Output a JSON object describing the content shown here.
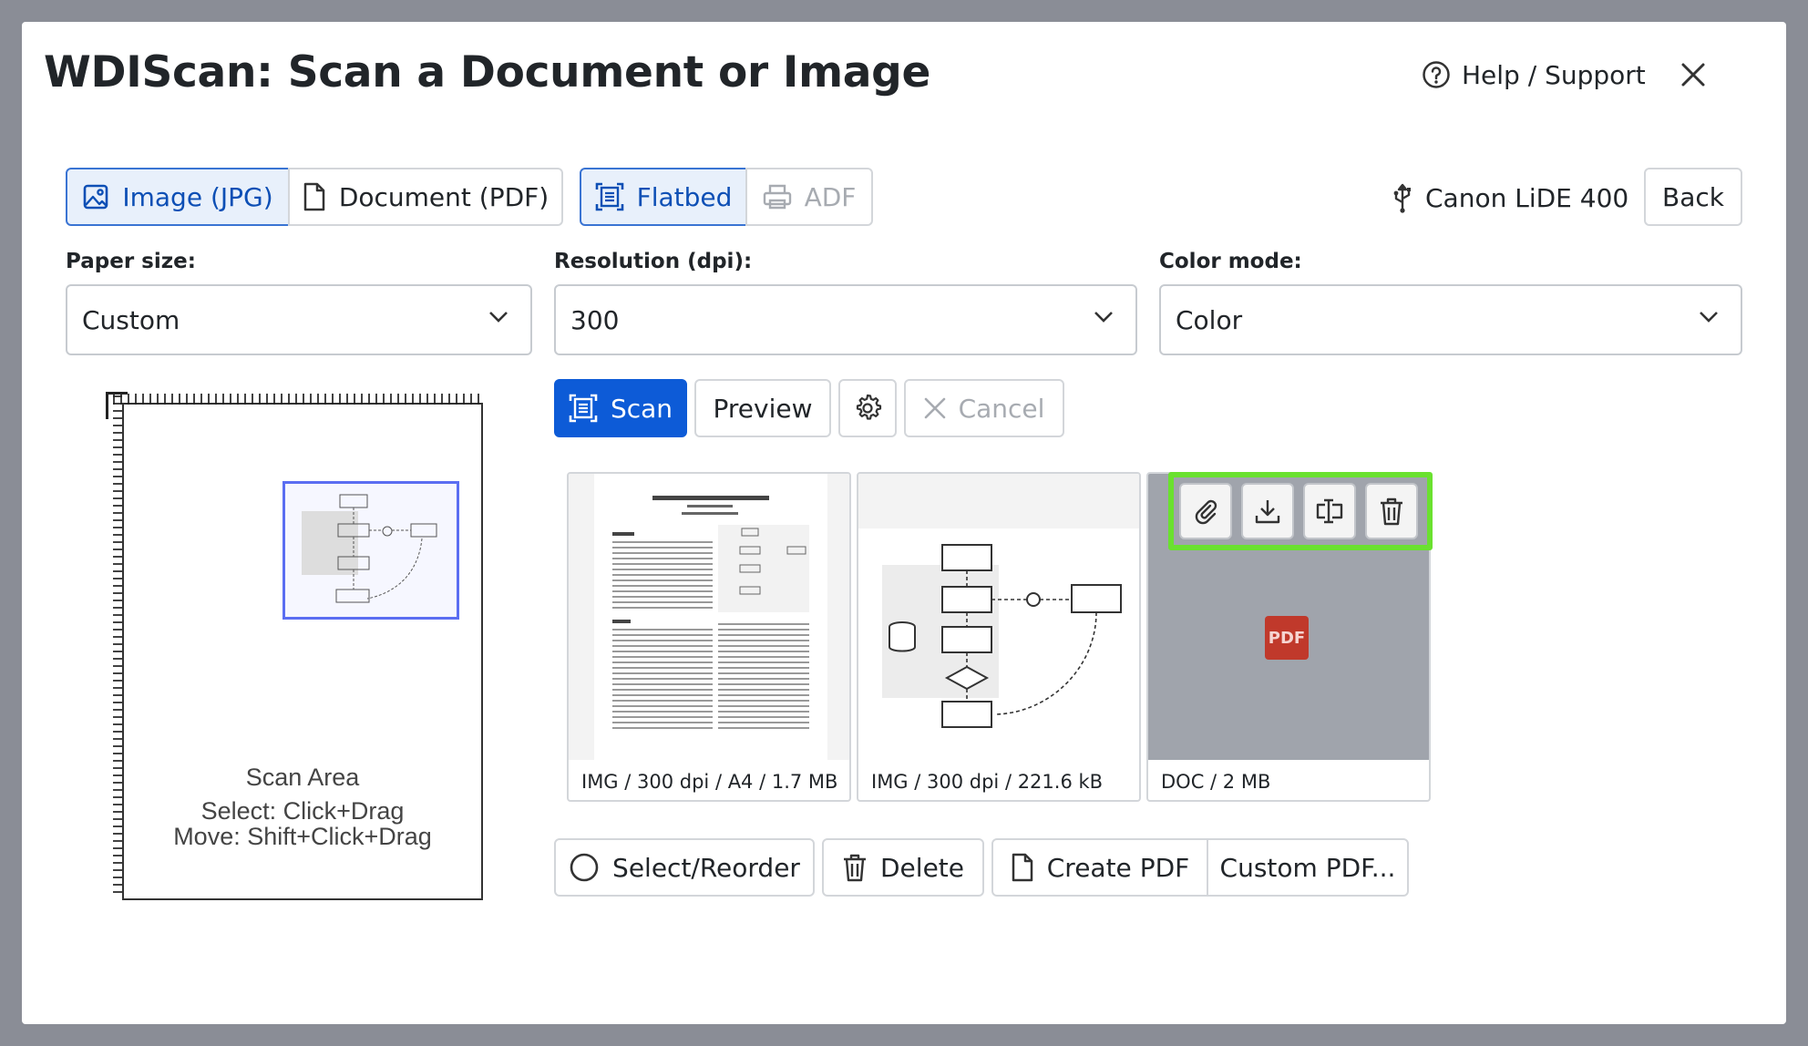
{
  "dialog": {
    "title": "WDIScan: Scan a Document or Image",
    "help_label": "Help / Support"
  },
  "format_tabs": [
    {
      "label": "Image (JPG)",
      "icon": "image-icon",
      "active": true
    },
    {
      "label": "Document (PDF)",
      "icon": "document-icon",
      "active": false
    }
  ],
  "source_tabs": [
    {
      "label": "Flatbed",
      "icon": "flatbed-icon",
      "active": true
    },
    {
      "label": "ADF",
      "icon": "printer-icon",
      "active": false,
      "disabled": true
    }
  ],
  "device": {
    "name": "Canon LiDE 400",
    "icon": "usb-icon"
  },
  "back_label": "Back",
  "settings": {
    "paper_size": {
      "label": "Paper size:",
      "value": "Custom"
    },
    "resolution": {
      "label": "Resolution (dpi):",
      "value": "300"
    },
    "color_mode": {
      "label": "Color mode:",
      "value": "Color"
    }
  },
  "actions": {
    "scan": "Scan",
    "preview": "Preview",
    "cancel": "Cancel"
  },
  "scan_area": {
    "title": "Scan Area",
    "hint_select": "Select: Click+Drag",
    "hint_move": "Move: Shift+Click+Drag"
  },
  "thumbnails": [
    {
      "caption": "IMG / 300 dpi / A4 / 1.7 MB",
      "kind": "image"
    },
    {
      "caption": "IMG / 300 dpi / 221.6 kB",
      "kind": "image"
    },
    {
      "caption": "DOC / 2 MB",
      "kind": "pdf",
      "badge": "PDF"
    }
  ],
  "thumb_toolbar": [
    "attach-icon",
    "download-icon",
    "rename-icon",
    "trash-icon"
  ],
  "bottom_actions": {
    "select_reorder": "Select/Reorder",
    "delete": "Delete",
    "create_pdf": "Create PDF",
    "custom_pdf": "Custom PDF..."
  },
  "colors": {
    "primary": "#0d5bd7",
    "active_bg": "#e8f0fb",
    "highlight": "#6ae12f",
    "pdf_badge": "#c0392b"
  }
}
